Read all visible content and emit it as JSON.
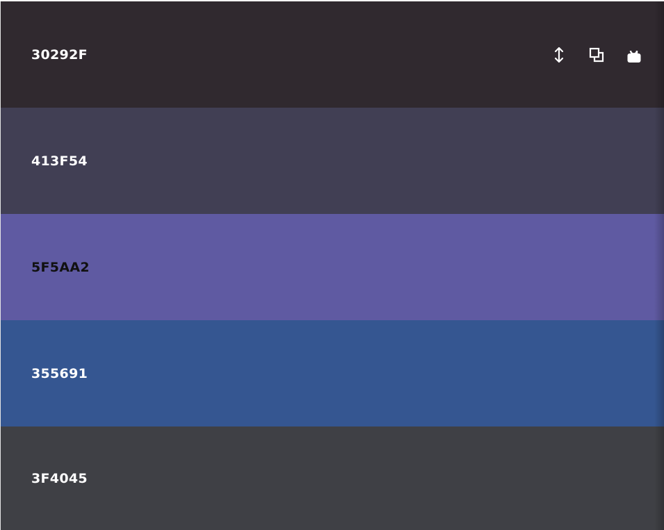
{
  "swatches": [
    {
      "hex": "30292F",
      "color": "#30292F",
      "text_color": "#ffffff"
    },
    {
      "hex": "413F54",
      "color": "#413F54",
      "text_color": "#ffffff"
    },
    {
      "hex": "5F5AA2",
      "color": "#5F5AA2",
      "text_color": "#111111"
    },
    {
      "hex": "355691",
      "color": "#355691",
      "text_color": "#ffffff"
    },
    {
      "hex": "3F4045",
      "color": "#3F4045",
      "text_color": "#ffffff"
    }
  ],
  "active_swatch_actions": [
    {
      "icon": "drag-vertical-icon"
    },
    {
      "icon": "copy-icon"
    },
    {
      "icon": "unlock-icon"
    }
  ]
}
